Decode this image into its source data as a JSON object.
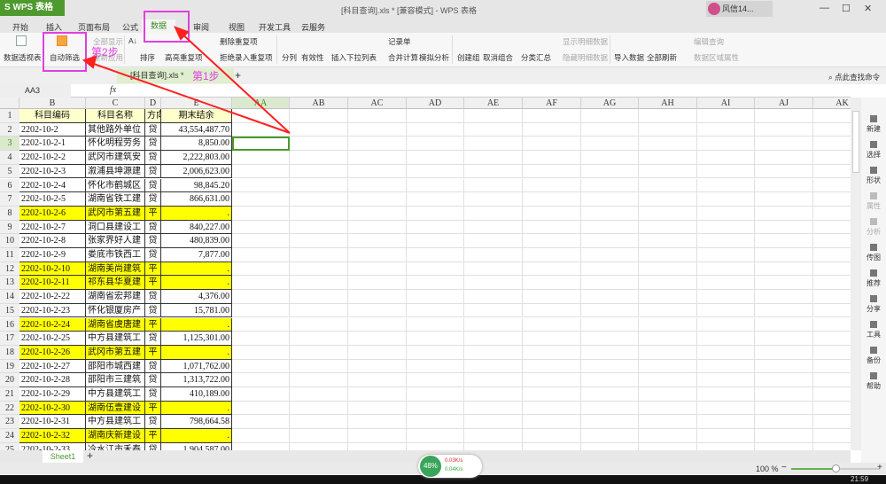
{
  "app": {
    "logo": "S WPS 表格",
    "title": "[科目查询].xls * [兼容模式] - WPS 表格",
    "user": "风信14...",
    "time": "21:59"
  },
  "tabs": [
    "开始",
    "插入",
    "页面布局",
    "公式",
    "数据",
    "审阅",
    "视图",
    "开发工具",
    "云服务"
  ],
  "active_tab": "数据",
  "ribbon": {
    "pivot": "数据透视表",
    "autofilter": "自动筛选",
    "show_all": "全部显示",
    "reapply": "重新应用",
    "sort": "排序",
    "highlight_dup": "高亮重复项",
    "delete_dup": "删除重复项",
    "reject_dup": "拒绝录入重复项",
    "split": "分列",
    "validity": "有效性",
    "insert_dropdown": "插入下拉列表",
    "record": "记录单",
    "consolidate": "合并计算",
    "simulate": "模拟分析",
    "group": "创建组",
    "ungroup": "取消组合",
    "subtotal": "分类汇总",
    "show_detail": "显示明细数据",
    "hide_detail": "隐藏明细数据",
    "import": "导入数据",
    "refresh_all": "全部刷新",
    "edit_query": "编辑查询",
    "range_props": "数据区域属性"
  },
  "doc_tab": "[科目查询].xls *",
  "search_cmd": "点此查找命令",
  "name_box": "AA3",
  "fx": "fx",
  "columns": [
    "B",
    "C",
    "D",
    "E",
    "AA",
    "AB",
    "AC",
    "AD",
    "AE",
    "AF",
    "AG",
    "AH",
    "AI",
    "AJ",
    "AK"
  ],
  "rows": [
    [
      "1",
      "科目编码",
      "科目名称",
      "方向",
      "期末结余",
      false
    ],
    [
      "2",
      "2202-10-2",
      "其他路外单位",
      "贷",
      "43,554,487.70",
      false
    ],
    [
      "3",
      "2202-10-2-1",
      "怀化明程劳务",
      "贷",
      "8,850.00",
      false
    ],
    [
      "4",
      "2202-10-2-2",
      "武冈市建筑安",
      "贷",
      "2,222,803.00",
      false
    ],
    [
      "5",
      "2202-10-2-3",
      "溆浦县坤源建",
      "贷",
      "2,006,623.00",
      false
    ],
    [
      "6",
      "2202-10-2-4",
      "怀化市鹤城区",
      "贷",
      "98,845.20",
      false
    ],
    [
      "7",
      "2202-10-2-5",
      "湖南省铁工建",
      "贷",
      "866,631.00",
      false
    ],
    [
      "8",
      "2202-10-2-6",
      "武冈市第五建",
      "平",
      ".",
      true
    ],
    [
      "9",
      "2202-10-2-7",
      "洞口县建设工",
      "贷",
      "840,227.00",
      false
    ],
    [
      "10",
      "2202-10-2-8",
      "张家界好人建",
      "贷",
      "480,839.00",
      false
    ],
    [
      "11",
      "2202-10-2-9",
      "娄底市铁西工",
      "贷",
      "7,877.00",
      false
    ],
    [
      "12",
      "2202-10-2-10",
      "湖南美尚建筑",
      "平",
      ".",
      true
    ],
    [
      "13",
      "2202-10-2-11",
      "祁东县华夏建",
      "平",
      ".",
      true
    ],
    [
      "14",
      "2202-10-2-22",
      "湖南省宏邦建",
      "贷",
      "4,376.00",
      false
    ],
    [
      "15",
      "2202-10-2-23",
      "怀化银厦房产",
      "贷",
      "15,781.00",
      false
    ],
    [
      "16",
      "2202-10-2-24",
      "湖南省虞唐建",
      "平",
      ".",
      true
    ],
    [
      "17",
      "2202-10-2-25",
      "中方县建筑工",
      "贷",
      "1,125,301.00",
      false
    ],
    [
      "18",
      "2202-10-2-26",
      "武冈市第五建",
      "平",
      ".",
      true
    ],
    [
      "19",
      "2202-10-2-27",
      "邵阳市城西建",
      "贷",
      "1,071,762.00",
      false
    ],
    [
      "20",
      "2202-10-2-28",
      "邵阳市三建筑",
      "贷",
      "1,313,722.00",
      false
    ],
    [
      "21",
      "2202-10-2-29",
      "中方县建筑工",
      "贷",
      "410,189.00",
      false
    ],
    [
      "22",
      "2202-10-2-30",
      "湖南伍壹建设",
      "平",
      ".",
      true
    ],
    [
      "23",
      "2202-10-2-31",
      "中方县建筑工",
      "贷",
      "798,664.58",
      false
    ],
    [
      "24",
      "2202-10-2-32",
      "湖南庆新建设",
      "平",
      ".",
      true
    ],
    [
      "25",
      "2202-10-2-33",
      "冷水江市禾泰",
      "贷",
      "1,904,587.00",
      false
    ]
  ],
  "side": [
    "新建",
    "选择",
    "形状",
    "属性",
    "分析",
    "传图",
    "推荐",
    "分享",
    "工具",
    "备份",
    "帮助"
  ],
  "sheet": "Sheet1",
  "zoom": "100 %",
  "zoom_level": 100,
  "net": {
    "pct": "48%",
    "up": "0.03K/s",
    "down": "0.04K/s"
  },
  "annotations": {
    "step1": "第1步",
    "step2": "第2步",
    "color": "#e040e0",
    "arrow_color": "#ff2020"
  }
}
